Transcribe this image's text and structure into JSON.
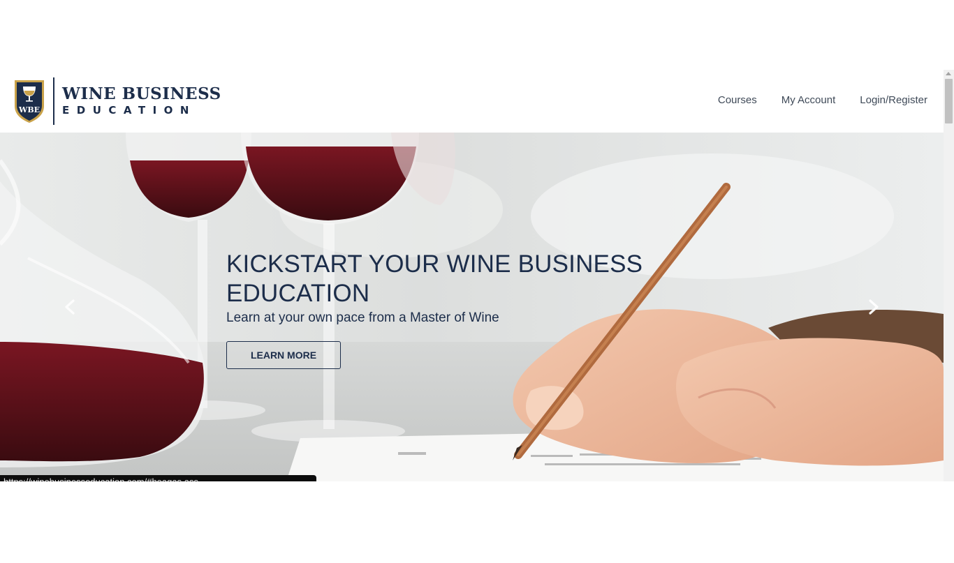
{
  "brand": {
    "line1": "WINE BUSINESS",
    "line2": "EDUCATION",
    "monogram": "WBE",
    "colors": {
      "navy": "#1c2d4a",
      "gold": "#c9a24a"
    }
  },
  "nav": {
    "items": [
      {
        "label": "Courses"
      },
      {
        "label": "My Account"
      },
      {
        "label": "Login/Register"
      }
    ]
  },
  "hero": {
    "title": "KICKSTART YOUR WINE BUSINESS EDUCATION",
    "subtitle": "Learn at your own pace from a Master of Wine",
    "cta_label": "LEARN MORE",
    "prev_icon": "chevron-left-icon",
    "next_icon": "chevron-right-icon"
  },
  "status": {
    "url": "https://winebusinesseducation.com/#heagas ass"
  }
}
